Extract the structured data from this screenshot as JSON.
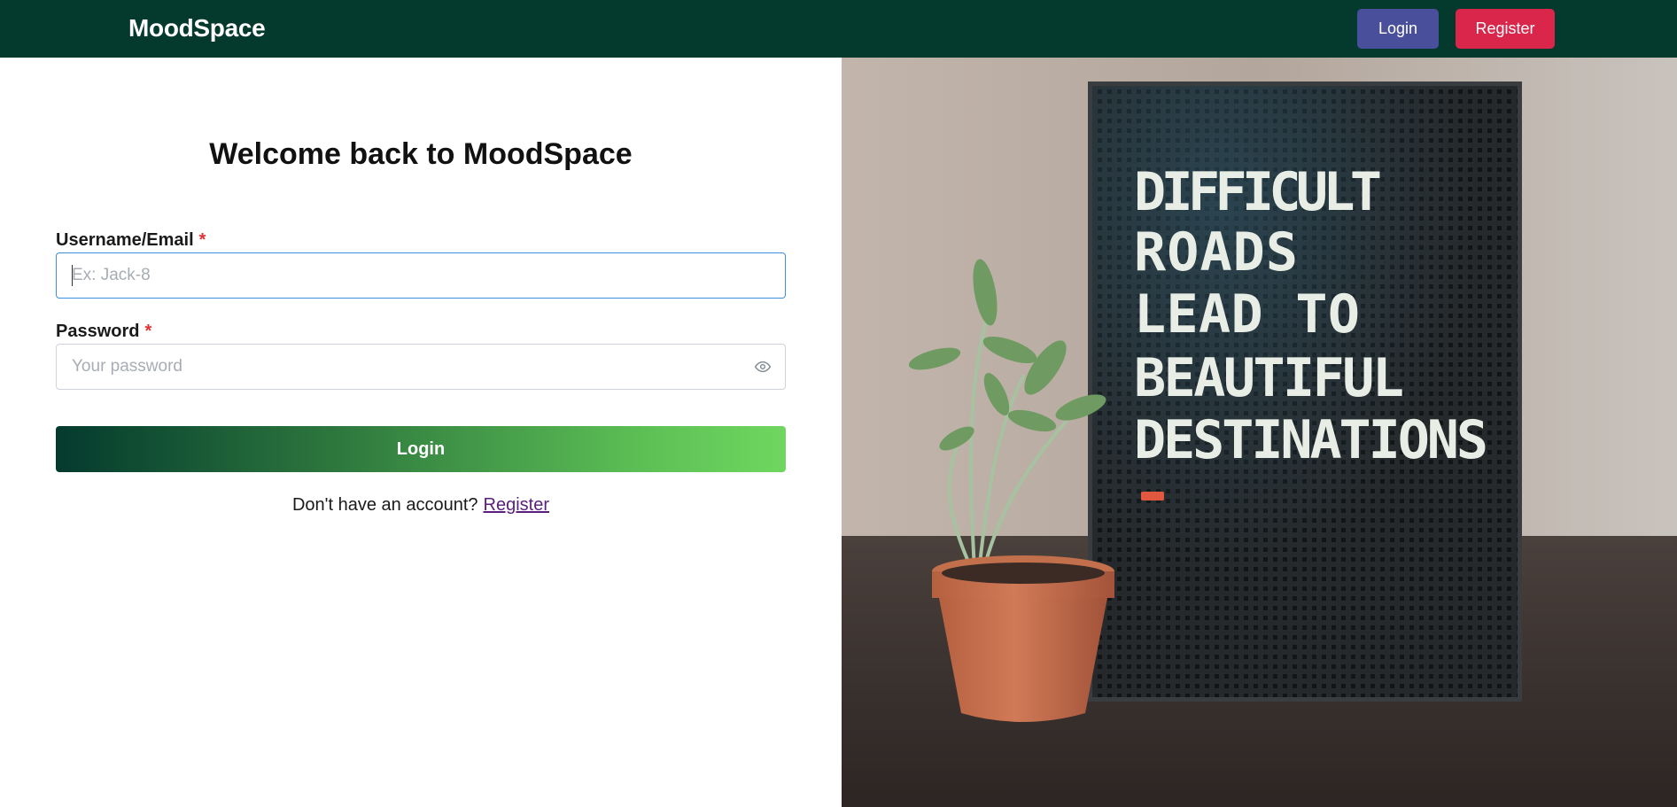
{
  "navbar": {
    "brand": "MoodSpace",
    "login_label": "Login",
    "register_label": "Register"
  },
  "form": {
    "title": "Welcome back to MoodSpace",
    "username_label": "Username/Email",
    "username_placeholder": "Ex: Jack-8",
    "username_value": "",
    "password_label": "Password",
    "password_placeholder": "Your password",
    "password_value": "",
    "required_marker": "*",
    "submit_label": "Login",
    "footer_prompt": "Don't have an account?",
    "footer_link": "Register"
  },
  "hero_image": {
    "board_lines": [
      "DIFFICULT",
      "ROADS",
      "LEAD TO",
      "BEAUTIFUL",
      "DESTINATIONS"
    ]
  },
  "icons": {
    "password_toggle": "eye-icon"
  },
  "colors": {
    "navbar_bg": "#043a2e",
    "nav_login_bg": "#4a4f9c",
    "nav_register_bg": "#d9264a",
    "required": "#e03131",
    "link": "#5a1f7c",
    "focus_border": "#3d8fe0"
  }
}
